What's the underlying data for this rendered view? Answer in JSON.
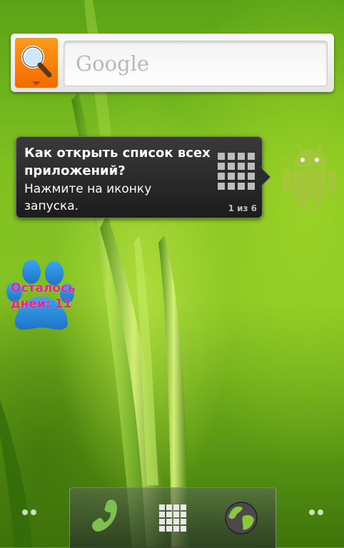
{
  "search": {
    "placeholder": "Google"
  },
  "tooltip": {
    "title": "Как открыть список всех приложений?",
    "body": "Нажмите на иконку запуска.",
    "counter": "1 из 6"
  },
  "widget": {
    "days_left": "Осталось дней: 11"
  },
  "dock": {
    "items": [
      "phone-icon",
      "app-launcher-icon",
      "browser-icon"
    ]
  },
  "colors": {
    "search_button": "#f26a00",
    "days_text": "#e62593",
    "android_green": "#a4c639",
    "paw_blue": "#2a8fe0"
  }
}
